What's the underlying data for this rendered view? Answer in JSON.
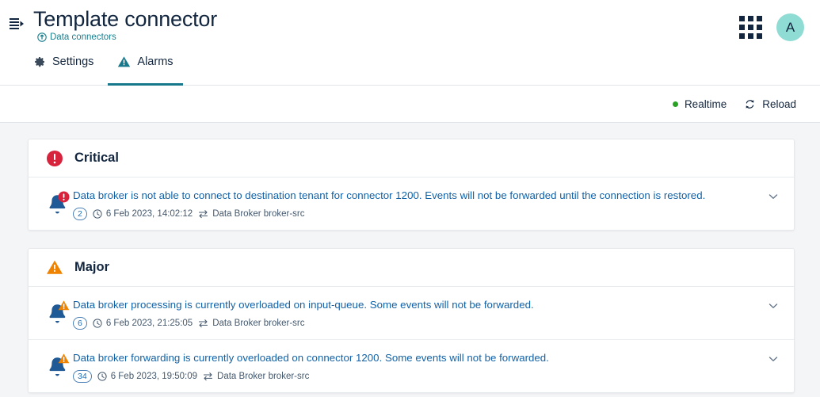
{
  "header": {
    "menu_icon": "list-collapse-icon",
    "title": "Template connector",
    "breadcrumb": {
      "icon": "upload-circle-icon",
      "label": "Data connectors"
    },
    "apps_icon": "grid-apps-icon",
    "avatar_initial": "A"
  },
  "tabs": [
    {
      "id": "settings",
      "label": "Settings",
      "icon": "gear-icon",
      "active": false
    },
    {
      "id": "alarms",
      "label": "Alarms",
      "icon": "warning-triangle-icon",
      "active": true
    }
  ],
  "toolbar": {
    "realtime_label": "Realtime",
    "realtime_status_color": "#2aa125",
    "reload_label": "Reload",
    "reload_icon": "refresh-icon"
  },
  "colors": {
    "critical": "#d8233d",
    "major": "#ef8300",
    "accent": "#17788c",
    "link": "#1262a8",
    "page_bg": "#f4f5f6"
  },
  "sections": [
    {
      "id": "critical",
      "title": "Critical",
      "icon": "error-circle-icon",
      "alarms": [
        {
          "message": "Data broker is not able to connect to destination tenant for connector 1200. Events will not be forwarded until the connection is restored.",
          "count": "2",
          "timestamp": "6 Feb 2023, 14:02:12",
          "source": "Data Broker broker-src",
          "clock_icon": "clock-icon",
          "source_icon": "transfer-icon",
          "expand_icon": "chevron-down-icon"
        }
      ]
    },
    {
      "id": "major",
      "title": "Major",
      "icon": "warning-triangle-icon",
      "alarms": [
        {
          "message": "Data broker processing is currently overloaded on input-queue. Some events will not be forwarded.",
          "count": "6",
          "timestamp": "6 Feb 2023, 21:25:05",
          "source": "Data Broker broker-src",
          "clock_icon": "clock-icon",
          "source_icon": "transfer-icon",
          "expand_icon": "chevron-down-icon"
        },
        {
          "message": "Data broker forwarding is currently overloaded on connector 1200. Some events will not be forwarded.",
          "count": "34",
          "timestamp": "6 Feb 2023, 19:50:09",
          "source": "Data Broker broker-src",
          "clock_icon": "clock-icon",
          "source_icon": "transfer-icon",
          "expand_icon": "chevron-down-icon"
        }
      ]
    }
  ]
}
